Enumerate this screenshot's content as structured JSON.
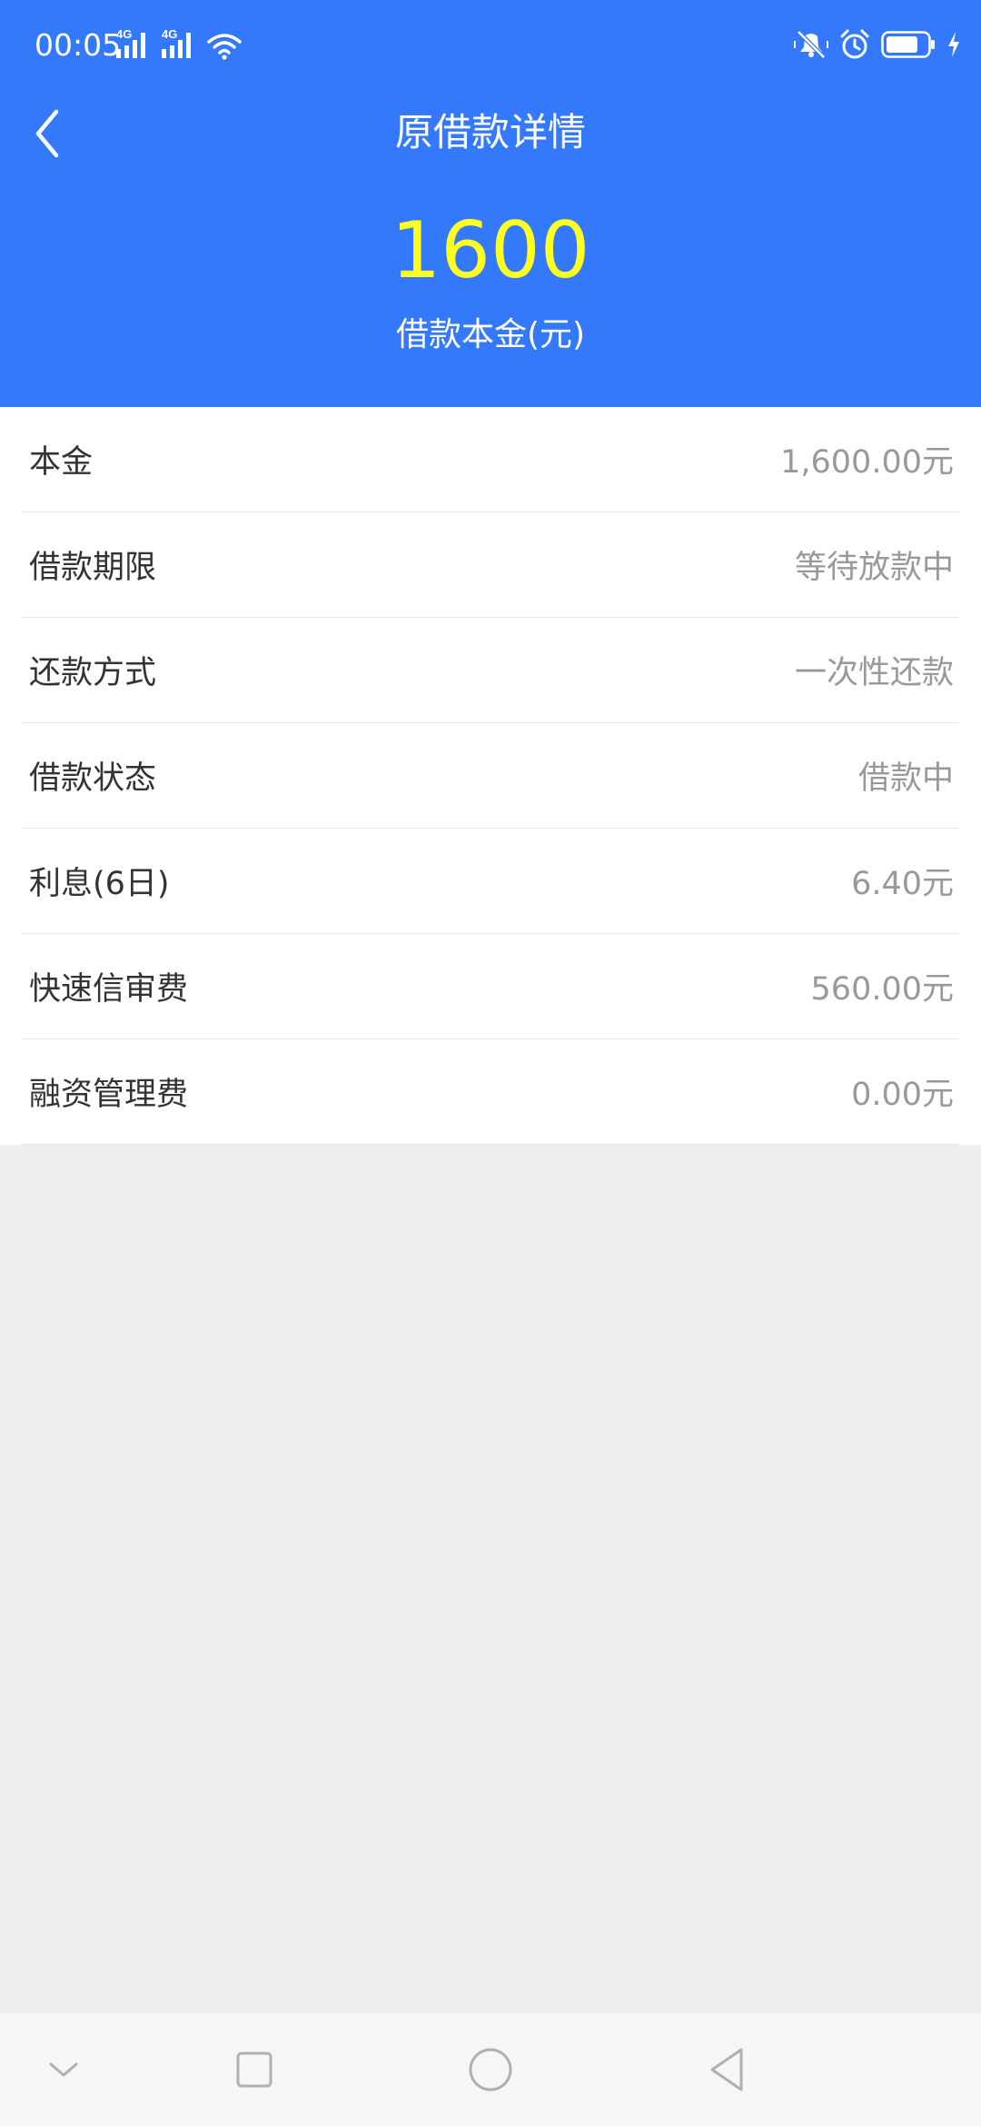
{
  "status_bar": {
    "time": "00:05",
    "network_label_1": "4G",
    "network_label_2": "4G"
  },
  "nav": {
    "title": "原借款详情"
  },
  "summary": {
    "amount": "1600",
    "amount_label": "借款本金(元)"
  },
  "details": [
    {
      "label": "本金",
      "value": "1,600.00元"
    },
    {
      "label": "借款期限",
      "value": "等待放款中"
    },
    {
      "label": "还款方式",
      "value": "一次性还款"
    },
    {
      "label": "借款状态",
      "value": "借款中"
    },
    {
      "label": "利息(6日)",
      "value": "6.40元"
    },
    {
      "label": "快速信审费",
      "value": "560.00元"
    },
    {
      "label": "融资管理费",
      "value": "0.00元"
    }
  ],
  "colors": {
    "header_bg": "#3478fc",
    "amount": "#ffff22",
    "label_text": "#333333",
    "value_text": "#999999",
    "page_bg": "#eeeeee"
  },
  "icons": {
    "status_left": [
      "signal-4g-icon",
      "signal-4g-icon",
      "wifi-icon"
    ],
    "status_right": [
      "mute-icon",
      "alarm-icon",
      "battery-icon",
      "charging-icon"
    ],
    "nav": [
      "chevron-left-icon"
    ],
    "system_nav": [
      "chevron-down-icon",
      "square-icon",
      "circle-icon",
      "triangle-back-icon"
    ]
  }
}
